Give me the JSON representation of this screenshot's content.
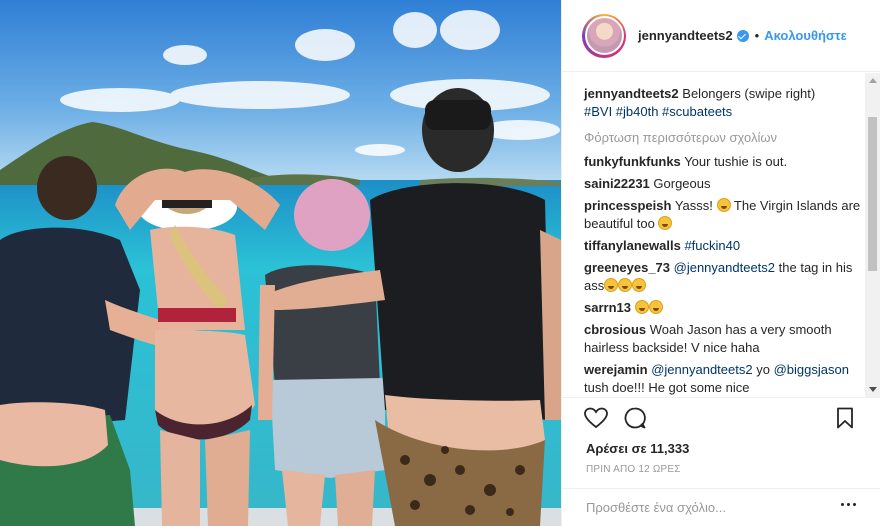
{
  "post": {
    "image_alt": "",
    "header": {
      "username": "jennyandteets2",
      "separator": "•",
      "follow_label": "Ακολουθήστε"
    },
    "caption": {
      "username": "jennyandteets2",
      "text": "Belongers (swipe right)",
      "hashtags": "#BVI #jb40th #scubateets"
    },
    "load_more": "Φόρτωση περισσότερων σχολίων",
    "comments": [
      {
        "user": "funkyfunkfunks",
        "text": "Your tushie is out."
      },
      {
        "user": "saini22231",
        "text": "Gorgeous"
      },
      {
        "user": "princesspeish",
        "text": "Yasss!",
        "text2": "The Virgin Islands are beautiful too"
      },
      {
        "user": "tiffanylanewalls",
        "tag": "#fuckin40"
      },
      {
        "user": "greeneyes_73",
        "mention": "@jennyandteets2",
        "text": "the tag in his ass"
      },
      {
        "user": "sarrn13"
      },
      {
        "user": "cbrosious",
        "text": "Woah Jason has a very smooth hairless backside! V nice haha"
      },
      {
        "user": "werejamin",
        "mention": "@jennyandteets2",
        "text": "yo",
        "mention2": "@biggsjason",
        "text2": "tush doe!!! He got some nice"
      }
    ],
    "likes": "Αρέσει σε 11,333",
    "timestamp": "ΠΡΙΝ ΑΠΟ 12 ΩΡΕΣ",
    "add_comment_placeholder": "Προσθέστε ένα σχόλιο...",
    "icons": [
      "heart-icon",
      "comment-icon",
      "bookmark-icon",
      "more-options-icon",
      "verified-badge-icon"
    ],
    "colors": {
      "link": "#3897f0",
      "hashtag": "#003569",
      "muted": "#999999"
    }
  }
}
